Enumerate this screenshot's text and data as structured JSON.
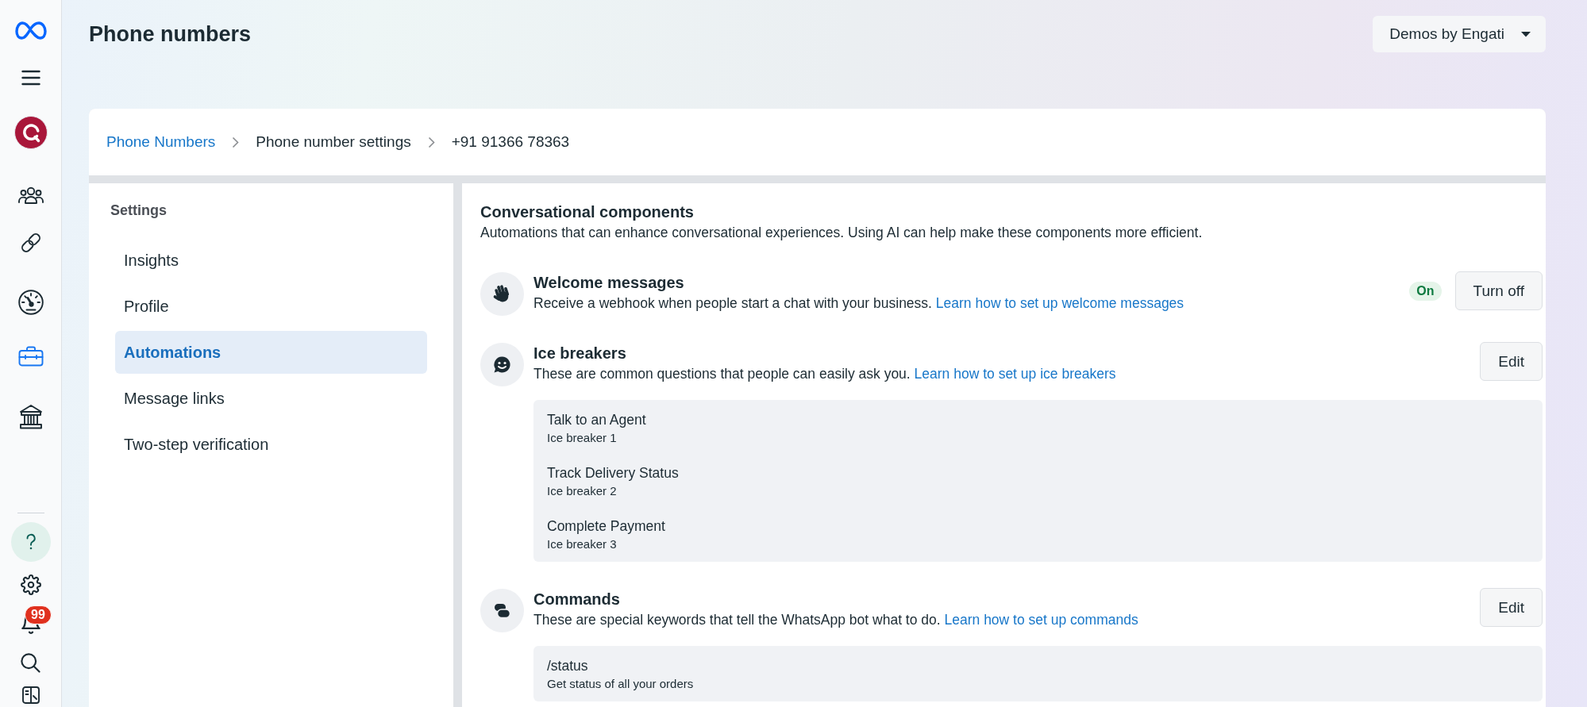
{
  "rail": {
    "top_icons": [
      {
        "kind": "logo"
      },
      {
        "kind": "menu"
      },
      {
        "kind": "account"
      }
    ],
    "nav_items": [
      {
        "kind": "people",
        "selected": false
      },
      {
        "kind": "link",
        "selected": false
      },
      {
        "kind": "gauge",
        "selected": false
      },
      {
        "kind": "briefcase",
        "selected": true
      },
      {
        "kind": "bank",
        "selected": false
      }
    ],
    "bottom_icons": [
      {
        "kind": "help"
      },
      {
        "kind": "settings"
      },
      {
        "kind": "bell",
        "badge": "99"
      },
      {
        "kind": "search"
      },
      {
        "kind": "panel"
      }
    ]
  },
  "header": {
    "title": "Phone numbers",
    "account_menu": "Demos by Engati"
  },
  "breadcrumb": [
    {
      "label": "Phone Numbers",
      "kind": "link"
    },
    {
      "label": "Phone number settings",
      "kind": "text"
    },
    {
      "label": "+91 91366 78363",
      "kind": "text"
    }
  ],
  "settings_nav": {
    "heading": "Settings",
    "items": [
      {
        "label": "Insights",
        "selected": false
      },
      {
        "label": "Profile",
        "selected": false
      },
      {
        "label": "Automations",
        "selected": true
      },
      {
        "label": "Message links",
        "selected": false
      },
      {
        "label": "Two-step verification",
        "selected": false
      }
    ]
  },
  "components_panel": {
    "title": "Conversational components",
    "description": "Automations that can enhance conversational experiences. Using AI can help make these components more efficient.",
    "components": [
      {
        "kind": "welcome",
        "title": "Welcome messages",
        "description": "Receive a webhook when people start a chat with your business.",
        "link": "Learn how to set up welcome messages",
        "status": "On",
        "button": "Turn off"
      },
      {
        "kind": "icebreakers",
        "title": "Ice breakers",
        "description": "These are common questions that people can easily ask you.",
        "link": "Learn how to set up ice breakers",
        "button": "Edit",
        "entries": [
          {
            "text": "Talk to an Agent",
            "caption": "Ice breaker 1"
          },
          {
            "text": "Track Delivery Status",
            "caption": "Ice breaker 2"
          },
          {
            "text": "Complete Payment",
            "caption": "Ice breaker 3"
          }
        ]
      },
      {
        "kind": "commands",
        "title": "Commands",
        "description": "These are special keywords that tell the WhatsApp bot what to do.",
        "link": "Learn how to set up commands",
        "button": "Edit",
        "entries": [
          {
            "text": "/status",
            "caption": "Get status of all your orders"
          }
        ]
      }
    ]
  }
}
